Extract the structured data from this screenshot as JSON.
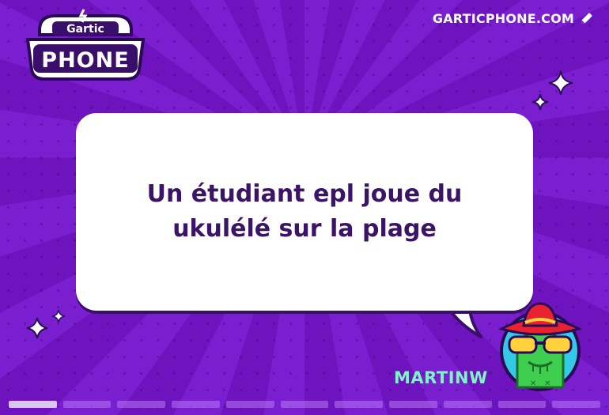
{
  "game": {
    "logo_top": "Gartic",
    "logo_main": "PHONE",
    "site_label": "GARTICPHONE.COM",
    "site_icon": "pencil-icon"
  },
  "card": {
    "caption": "Un étudiant epl joue du ukulélé sur la plage"
  },
  "player": {
    "name": "MARTINW",
    "avatar": "cactus-sombrero-sunglasses-avatar"
  },
  "progress": {
    "total_steps": 11,
    "current_step": 1
  },
  "colors": {
    "background": "#7418c4",
    "caption_text": "#3b1468",
    "username": "#7ff4c9",
    "bubble": "#ffffff"
  }
}
